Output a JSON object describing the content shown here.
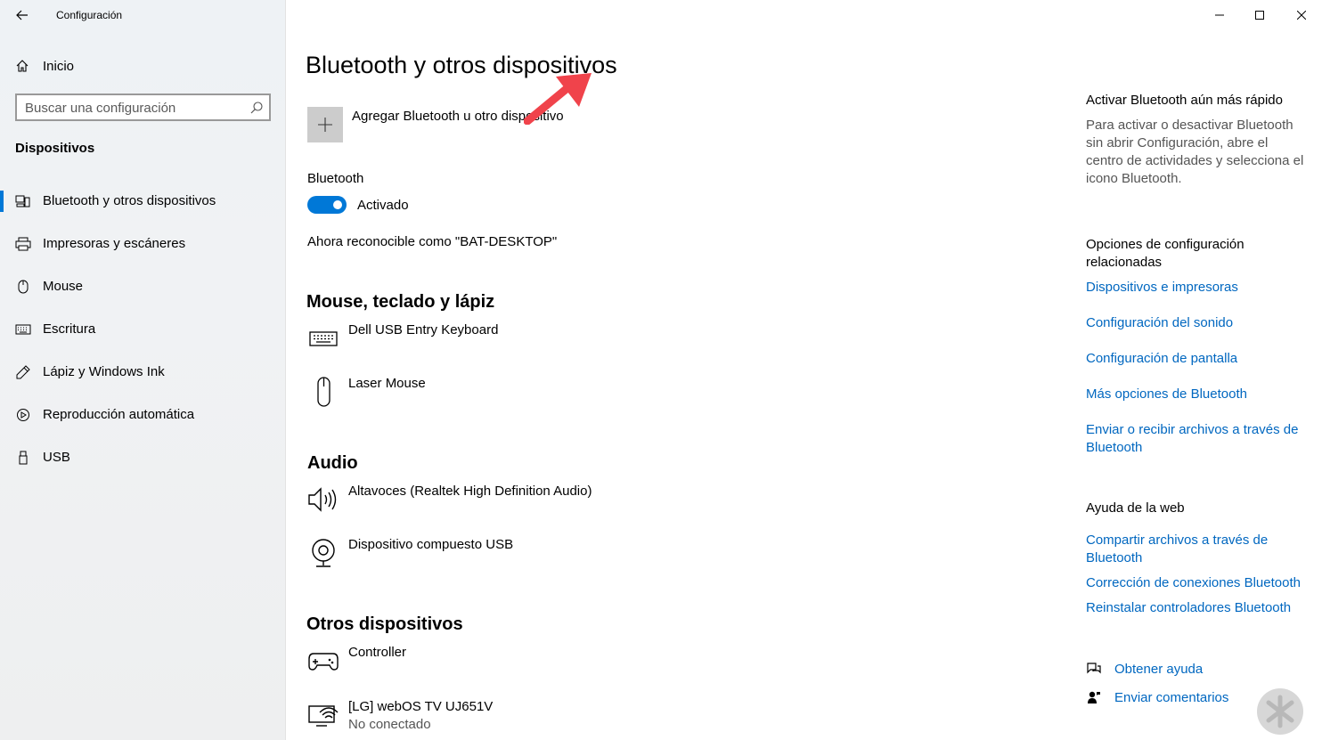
{
  "window": {
    "title": "Configuración",
    "controls": [
      "minimize",
      "maximize",
      "close"
    ]
  },
  "sidebar": {
    "home_label": "Inicio",
    "search_placeholder": "Buscar una configuración",
    "section_title": "Dispositivos",
    "items": [
      {
        "label": "Bluetooth y otros dispositivos",
        "icon": "bluetooth-devices-icon",
        "selected": true
      },
      {
        "label": "Impresoras y escáneres",
        "icon": "printer-icon",
        "selected": false
      },
      {
        "label": "Mouse",
        "icon": "mouse-icon",
        "selected": false
      },
      {
        "label": "Escritura",
        "icon": "keyboard-icon",
        "selected": false
      },
      {
        "label": "Lápiz y Windows Ink",
        "icon": "pen-icon",
        "selected": false
      },
      {
        "label": "Reproducción automática",
        "icon": "autoplay-icon",
        "selected": false
      },
      {
        "label": "USB",
        "icon": "usb-icon",
        "selected": false
      }
    ]
  },
  "main": {
    "title": "Bluetooth y otros dispositivos",
    "add_device_label": "Agregar Bluetooth u otro dispositivo",
    "bluetooth_label": "Bluetooth",
    "bluetooth_state": "Activado",
    "bluetooth_on": true,
    "discoverable_text": "Ahora reconocible como \"BAT-DESKTOP\"",
    "groups": {
      "input": {
        "heading": "Mouse, teclado y lápiz",
        "devices": [
          {
            "name": "Dell USB Entry Keyboard",
            "icon": "keyboard-icon"
          },
          {
            "name": "Laser Mouse",
            "icon": "mouse-icon"
          }
        ]
      },
      "audio": {
        "heading": "Audio",
        "devices": [
          {
            "name": "Altavoces (Realtek High Definition Audio)",
            "icon": "speaker-icon"
          },
          {
            "name": "Dispositivo compuesto USB",
            "icon": "webcam-icon"
          }
        ]
      },
      "other": {
        "heading": "Otros dispositivos",
        "devices": [
          {
            "name": "Controller",
            "icon": "gamepad-icon",
            "status": ""
          },
          {
            "name": "[LG] webOS TV UJ651V",
            "icon": "display-wireless-icon",
            "status": "No conectado"
          }
        ]
      }
    }
  },
  "right": {
    "tip_heading": "Activar Bluetooth aún más rápido",
    "tip_text": "Para activar o desactivar Bluetooth sin abrir Configuración, abre el centro de actividades y selecciona el icono Bluetooth.",
    "related_heading": "Opciones de configuración relacionadas",
    "related_links": [
      "Dispositivos e impresoras",
      "Configuración del sonido",
      "Configuración de pantalla",
      "Más opciones de Bluetooth",
      "Enviar o recibir archivos a través de Bluetooth"
    ],
    "web_heading": "Ayuda de la web",
    "web_links": [
      "Compartir archivos a través de Bluetooth",
      "Corrección de conexiones Bluetooth",
      "Reinstalar controladores Bluetooth"
    ],
    "help_label": "Obtener ayuda",
    "feedback_label": "Enviar comentarios"
  },
  "colors": {
    "accent": "#0078d7",
    "link": "#0067c0",
    "annotation_arrow": "#f0434b"
  }
}
